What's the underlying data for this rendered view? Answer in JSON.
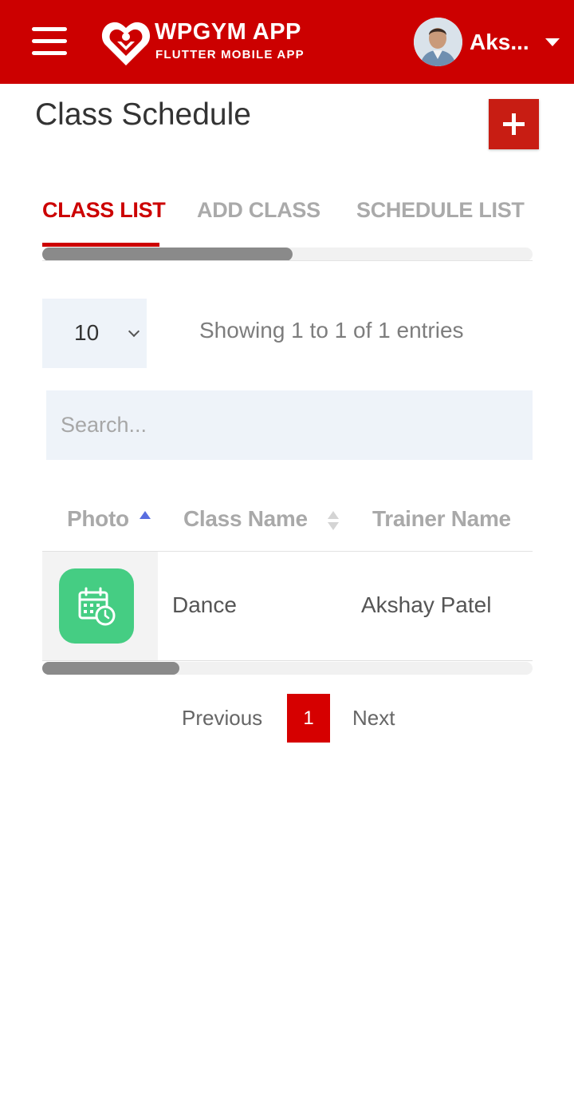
{
  "header": {
    "logo_title": "WPGYM APP",
    "logo_subtitle": "FLUTTER MOBILE APP",
    "user_name": "Aks...",
    "brand_color": "#cc0000"
  },
  "page": {
    "title": "Class Schedule",
    "add_icon": "plus-icon"
  },
  "tabs": [
    {
      "label": "CLASS LIST",
      "active": true
    },
    {
      "label": "ADD CLASS",
      "active": false
    },
    {
      "label": "SCHEDULE LIST",
      "active": false
    }
  ],
  "table_controls": {
    "entries_per_page": "10",
    "entries_info": "Showing 1 to 1 of 1 entries",
    "search_placeholder": "Search..."
  },
  "table": {
    "columns": [
      "Photo",
      "Class Name",
      "Trainer Name"
    ],
    "sorted_column": "Photo",
    "rows": [
      {
        "photo_icon": "calendar-clock-icon",
        "class_name": "Dance",
        "trainer_name": "Akshay Patel"
      }
    ]
  },
  "pagination": {
    "previous": "Previous",
    "current": "1",
    "next": "Next"
  }
}
